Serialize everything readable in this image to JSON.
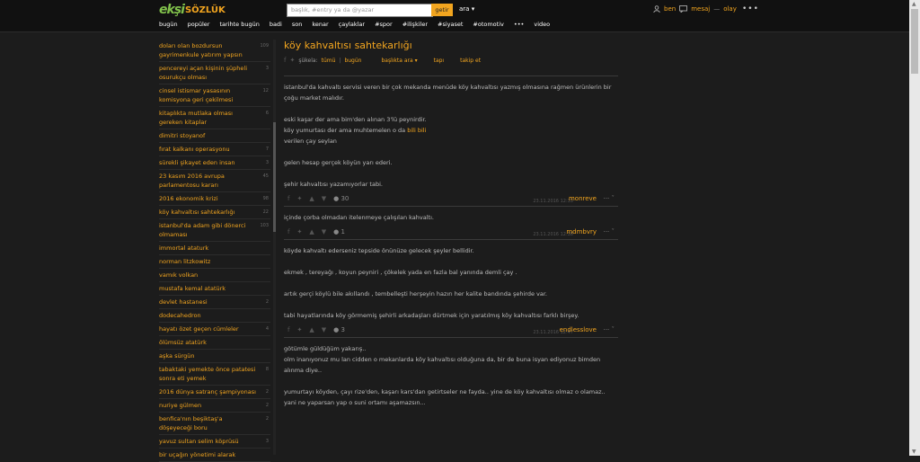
{
  "header": {
    "logo_eksi": "ekşi",
    "logo_sozluk": "SÖZLÜK",
    "search_placeholder": "başlık, #entry ya da @yazar",
    "search_button": "getir",
    "search_dropdown": "ara",
    "user": {
      "ben": "ben",
      "mesaj": "mesaj",
      "dash": "—",
      "olay": "olay"
    },
    "more": "•••"
  },
  "nav": [
    "bugün",
    "popüler",
    "tarihte bugün",
    "badi",
    "son",
    "kenar",
    "çaylaklar",
    "#spor",
    "#ilişkiler",
    "#siyaset",
    "#otomotiv",
    "•••",
    "video"
  ],
  "sidebar": [
    {
      "label": "doları olan bozdursun gayrimenkule yatırım yapsın",
      "count": "109"
    },
    {
      "label": "pencereyi açan kişinin şüpheli osurukçu olması",
      "count": "3"
    },
    {
      "label": "cinsel istismar yasasının komisyona geri çekilmesi",
      "count": "12"
    },
    {
      "label": "kitaplıkta mutlaka olması gereken kitaplar",
      "count": "6"
    },
    {
      "label": "dimitri stoyanof",
      "count": ""
    },
    {
      "label": "fırat kalkanı operasyonu",
      "count": "7"
    },
    {
      "label": "sürekli şikayet eden insan",
      "count": "3"
    },
    {
      "label": "23 kasım 2016 avrupa parlamentosu kararı",
      "count": "45"
    },
    {
      "label": "2016 ekonomik krizi",
      "count": "98"
    },
    {
      "label": "köy kahvaltısı sahtekarlığı",
      "count": "22"
    },
    {
      "label": "istanbul'da adam gibi dönerci olmaması",
      "count": "103"
    },
    {
      "label": "immortal ataturk",
      "count": ""
    },
    {
      "label": "norman litzkowitz",
      "count": ""
    },
    {
      "label": "vamık volkan",
      "count": ""
    },
    {
      "label": "mustafa kemal atatürk",
      "count": ""
    },
    {
      "label": "devlet hastanesi",
      "count": "2"
    },
    {
      "label": "dodecahedron",
      "count": ""
    },
    {
      "label": "hayatı özet geçen cümleler",
      "count": "4"
    },
    {
      "label": "ölümsüz atatürk",
      "count": ""
    },
    {
      "label": "aşka sürgün",
      "count": ""
    },
    {
      "label": "tabaktaki yemekte önce patatesi sonra eti yemek",
      "count": "8"
    },
    {
      "label": "2016 dünya satranç şampiyonası",
      "count": "2"
    },
    {
      "label": "nuriye gülmen",
      "count": "2"
    },
    {
      "label": "benfica'nın beşiktaş'a döşeyeceği boru",
      "count": "2"
    },
    {
      "label": "yavuz sultan selim köprüsü",
      "count": "3"
    },
    {
      "label": "bir uçağın yönetimi alarak",
      "count": ""
    }
  ],
  "topic": {
    "title": "köy kahvaltısı sahtekarlığı",
    "sub": {
      "sukela": "şükela:",
      "tumu": "tümü",
      "pipe": "|",
      "bugun": "bugün",
      "baskilarda": "başlıkta ara",
      "tapi": "tapı",
      "takip": "takip et"
    }
  },
  "entries": [
    {
      "lines": [
        "istanbul'da kahvaltı servisi veren bir çok mekanda menüde köy kahvaltısı yazmış olmasına rağmen ürünlerin bir çoğu market malıdır.",
        "",
        "eski kaşar der ama bim'den alınan 3'lü peynirdir.",
        "köy yumurtası der ama muhtemelen o da ",
        "verilen çay seylan",
        "",
        "gelen hesap gerçek köyün yarı ederi.",
        "",
        "şehir kahvaltısı yazamıyorlar tabi."
      ],
      "highlight": "bili bili",
      "fav": "30",
      "date": "23.11.2016 12:33",
      "author": "monreve"
    },
    {
      "lines": [
        "içinde çorba olmadan itelenmeye çalışılan kahvaltı."
      ],
      "fav": "1",
      "date": "23.11.2016 12:38",
      "author": "mdmbvry"
    },
    {
      "lines": [
        "köyde kahvaltı ederseniz tepside önünüze gelecek şeyler bellidir.",
        "",
        "ekmek , tereyağı , koyun peyniri , çökelek yada en fazla bal yanında demli çay .",
        "",
        "artık gerçi köylü bile akıllandı , tembelleşti herşeyin hazırı her kalite bandında şehirde var.",
        "",
        "tabi hayatlarında köy görmemiş şehirli arkadaşları dürtmek için yaratılmış köy kahvaltısı farklı birşey."
      ],
      "fav": "3",
      "date": "23.11.2016 12:47",
      "author": "endlesslove"
    },
    {
      "lines": [
        "götümle güldüğüm yakarış..",
        "olm inanıyonuz mu lan cidden o mekanlarda köy kahvaltısı olduğuna da, bir de buna isyan ediyonuz bimden alınma diye..",
        "",
        "yumurtayı köyden, çayı rize'den, kaşarı kars'dan getirtseler ne fayda.. yine de köy kahvaltısı olmaz o olamaz..",
        "yani ne yaparsan yap o suni ortamı aşamazsın..."
      ]
    }
  ]
}
